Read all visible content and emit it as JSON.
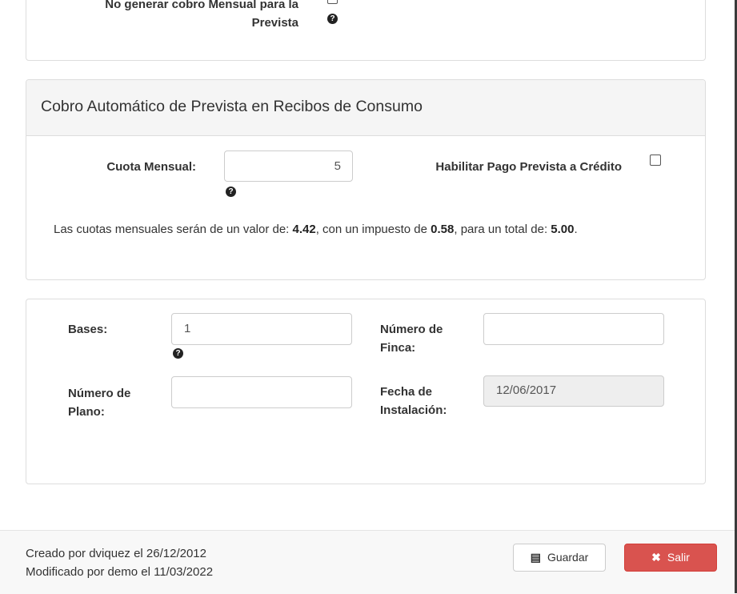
{
  "top_panel": {
    "no_cobro_label": "No generar cobro Mensual para la Prevista"
  },
  "prevista_panel": {
    "title": "Cobro Automático de Prevista en Recibos de Consumo",
    "cuota_label": "Cuota Mensual:",
    "cuota_value": "5",
    "credito_label": "Habilitar Pago Prevista a Crédito",
    "summary": {
      "prefix": "Las cuotas mensuales serán de un valor de: ",
      "valor": "4.42",
      "mid1": ", con un impuesto de ",
      "impuesto": "0.58",
      "mid2": ", para un total de: ",
      "total": "5.00",
      "suffix": "."
    }
  },
  "bases_panel": {
    "bases_label": "Bases:",
    "bases_value": "1",
    "finca_label_1": "Número de",
    "finca_label_2": "Finca:",
    "finca_value": "",
    "plano_label_1": "Número de",
    "plano_label_2": "Plano:",
    "plano_value": "",
    "fecha_label_1": "Fecha de",
    "fecha_label_2": "Instalación:",
    "fecha_value": "12/06/2017"
  },
  "footer": {
    "creado": "Creado por dviquez el 26/12/2012",
    "modificado": "Modificado por demo el 11/03/2022",
    "guardar_label": "Guardar",
    "salir_label": "Salir"
  },
  "icons": {
    "help": "question-circle-icon",
    "save": "floppy-disk-icon",
    "close": "times-icon"
  },
  "colors": {
    "danger": "#d9534f",
    "panel_heading": "#f5f5f5"
  }
}
